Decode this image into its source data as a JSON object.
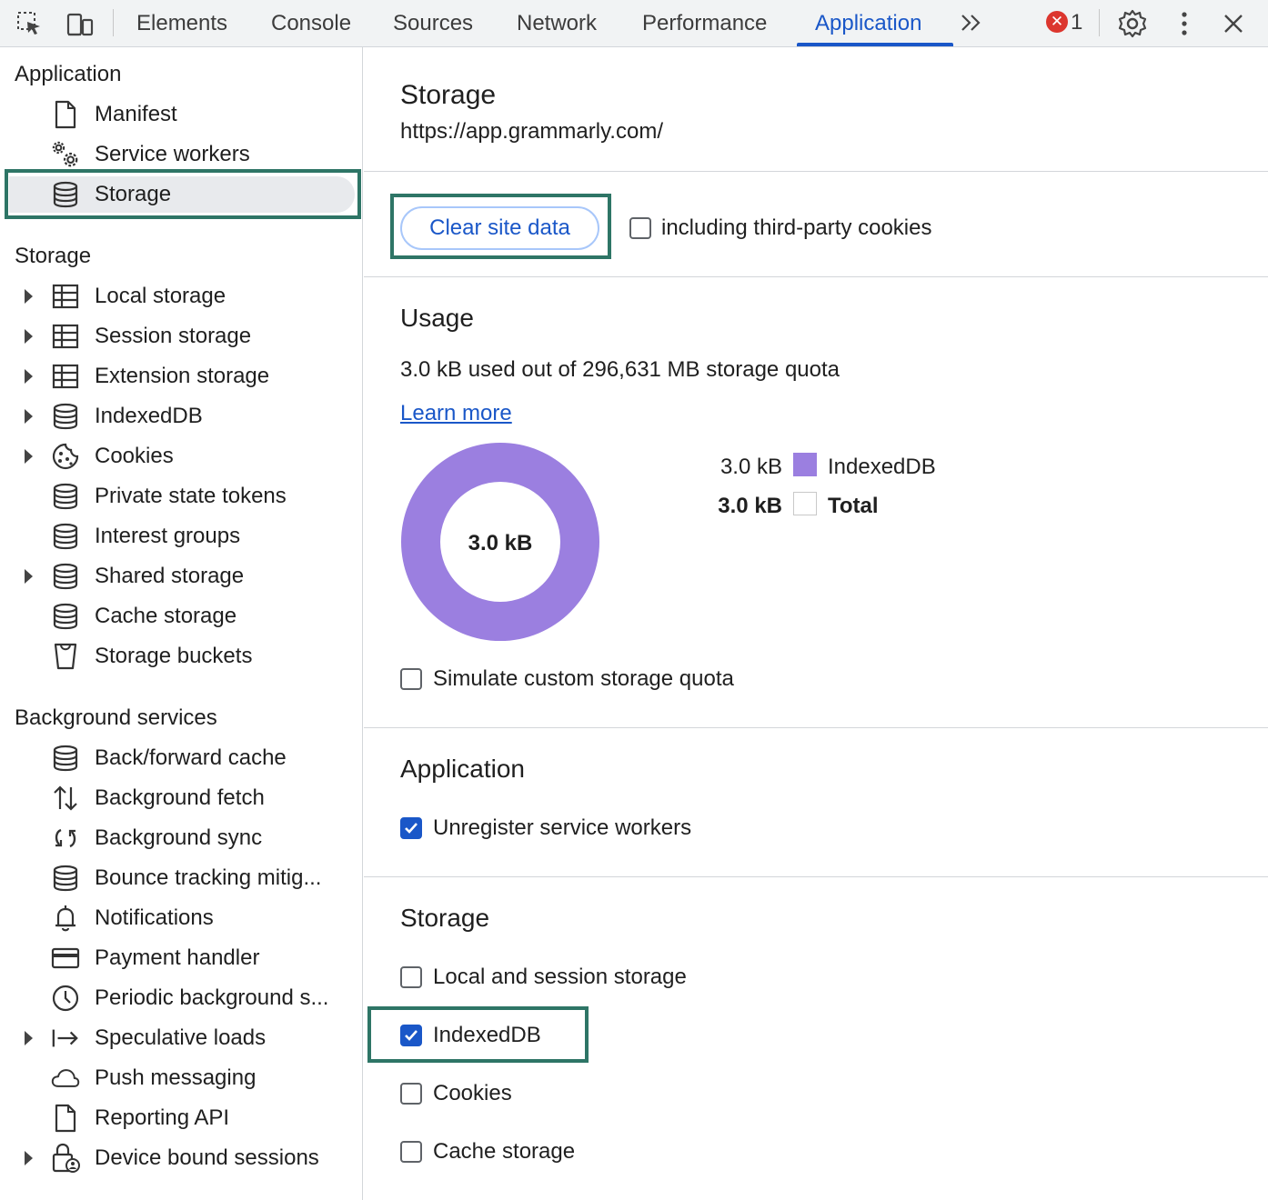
{
  "toolbar": {
    "tabs": [
      "Elements",
      "Console",
      "Sources",
      "Network",
      "Performance",
      "Application"
    ],
    "active_tab": "Application",
    "error_count": "1",
    "accent_color": "#1a57c8"
  },
  "sidebar": {
    "application": {
      "heading": "Application",
      "items": [
        {
          "label": "Manifest",
          "icon": "document-icon"
        },
        {
          "label": "Service workers",
          "icon": "gears-icon"
        },
        {
          "label": "Storage",
          "icon": "database-icon",
          "selected": true
        }
      ]
    },
    "storage": {
      "heading": "Storage",
      "items": [
        {
          "label": "Local storage",
          "icon": "table-icon",
          "expandable": true
        },
        {
          "label": "Session storage",
          "icon": "table-icon",
          "expandable": true
        },
        {
          "label": "Extension storage",
          "icon": "table-icon",
          "expandable": true
        },
        {
          "label": "IndexedDB",
          "icon": "database-icon",
          "expandable": true
        },
        {
          "label": "Cookies",
          "icon": "cookie-icon",
          "expandable": true
        },
        {
          "label": "Private state tokens",
          "icon": "database-icon"
        },
        {
          "label": "Interest groups",
          "icon": "database-icon"
        },
        {
          "label": "Shared storage",
          "icon": "database-icon",
          "expandable": true
        },
        {
          "label": "Cache storage",
          "icon": "database-icon"
        },
        {
          "label": "Storage buckets",
          "icon": "bucket-icon"
        }
      ]
    },
    "background": {
      "heading": "Background services",
      "items": [
        {
          "label": "Back/forward cache",
          "icon": "database-icon"
        },
        {
          "label": "Background fetch",
          "icon": "up-down-arrows-icon"
        },
        {
          "label": "Background sync",
          "icon": "sync-icon"
        },
        {
          "label": "Bounce tracking mitig...",
          "icon": "database-icon"
        },
        {
          "label": "Notifications",
          "icon": "bell-icon"
        },
        {
          "label": "Payment handler",
          "icon": "credit-card-icon"
        },
        {
          "label": "Periodic background s...",
          "icon": "clock-icon"
        },
        {
          "label": "Speculative loads",
          "icon": "arrow-right-bar-icon",
          "expandable": true
        },
        {
          "label": "Push messaging",
          "icon": "cloud-icon"
        },
        {
          "label": "Reporting API",
          "icon": "document-icon"
        },
        {
          "label": "Device bound sessions",
          "icon": "lock-person-icon",
          "expandable": true
        }
      ]
    }
  },
  "main": {
    "title": "Storage",
    "origin": "https://app.grammarly.com/",
    "clear_button": "Clear site data",
    "third_party_label": "including third-party cookies",
    "third_party_checked": false,
    "usage": {
      "heading": "Usage",
      "summary": "3.0 kB used out of 296,631 MB storage quota",
      "learn_more": "Learn more",
      "donut_center": "3.0 kB",
      "legend": [
        {
          "value": "3.0 kB",
          "label": "IndexedDB",
          "color": "#9b7fe0"
        },
        {
          "value": "3.0 kB",
          "label": "Total",
          "color": "#ffffff",
          "bold": true
        }
      ],
      "simulate_label": "Simulate custom storage quota",
      "simulate_checked": false
    },
    "application_section": {
      "heading": "Application",
      "options": [
        {
          "label": "Unregister service workers",
          "checked": true
        }
      ]
    },
    "storage_section": {
      "heading": "Storage",
      "options": [
        {
          "label": "Local and session storage",
          "checked": false
        },
        {
          "label": "IndexedDB",
          "checked": true
        },
        {
          "label": "Cookies",
          "checked": false
        },
        {
          "label": "Cache storage",
          "checked": false
        }
      ]
    }
  },
  "chart_data": {
    "type": "pie",
    "categories": [
      "IndexedDB"
    ],
    "values": [
      3.0
    ],
    "title": "",
    "center_label": "3.0 kB"
  }
}
